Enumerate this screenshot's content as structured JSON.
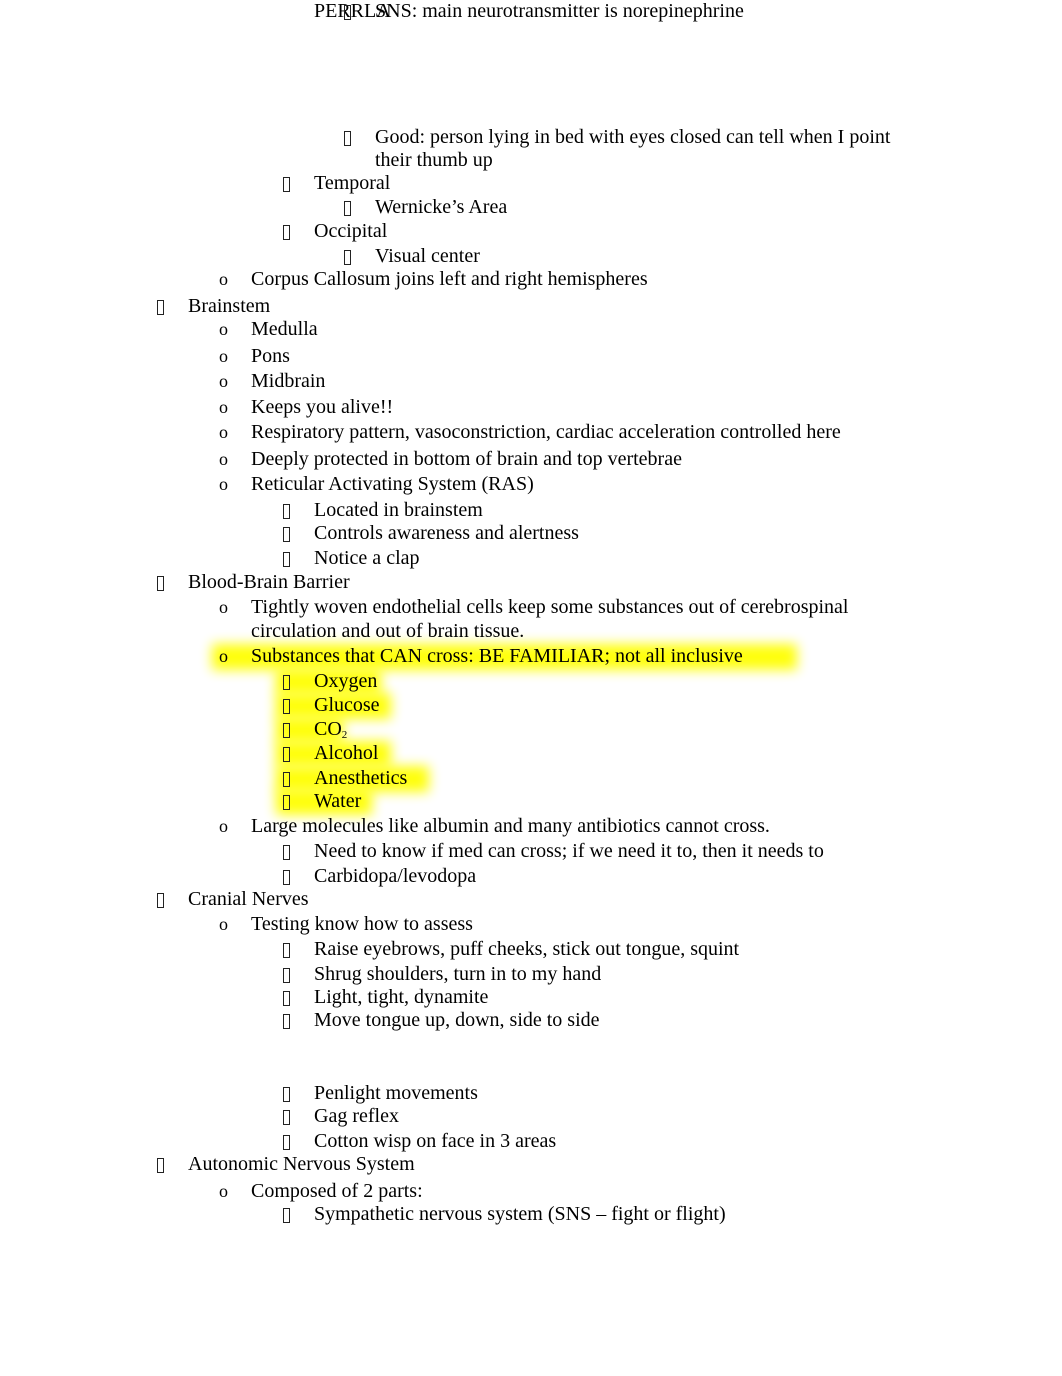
{
  "document": {
    "highlight_color": "#ffff00",
    "lines": [
      {
        "level": 4,
        "text": "Good: person lying in bed with eyes closed can tell when I point",
        "continuation": "their thumb up"
      },
      {
        "level": 3,
        "text": "Temporal"
      },
      {
        "level": 4,
        "text": "Wernicke’s Area"
      },
      {
        "level": 3,
        "text": "Occipital"
      },
      {
        "level": 4,
        "text": "Visual center"
      },
      {
        "level": 2,
        "text": "Corpus Callosum joins left and right hemispheres"
      },
      {
        "level": 1,
        "text": "Brainstem"
      },
      {
        "level": 2,
        "text": "Medulla"
      },
      {
        "level": 2,
        "text": "Pons"
      },
      {
        "level": 2,
        "text": "Midbrain"
      },
      {
        "level": 2,
        "text": "Keeps you alive!!"
      },
      {
        "level": 2,
        "text": "Respiratory pattern, vasoconstriction, cardiac acceleration controlled here"
      },
      {
        "level": 2,
        "text": "Deeply protected in bottom of brain and top vertebrae"
      },
      {
        "level": 2,
        "text": "Reticular Activating System (RAS)"
      },
      {
        "level": 3,
        "text": "Located in brainstem"
      },
      {
        "level": 3,
        "text": "Controls awareness and alertness"
      },
      {
        "level": 3,
        "text": "Notice a clap"
      },
      {
        "level": 1,
        "text": "Blood-Brain Barrier"
      },
      {
        "level": 2,
        "text": "Tightly woven endothelial cells keep some substances out of cerebrospinal",
        "continuation": "circulation and out of brain tissue."
      },
      {
        "level": 2,
        "text": "Substances that CAN cross: BE FAMILIAR; not all inclusive",
        "highlighted": true
      },
      {
        "level": 3,
        "text": "Oxygen",
        "highlighted": true
      },
      {
        "level": 3,
        "text": "Glucose",
        "highlighted": true
      },
      {
        "level": 3,
        "text": "CO",
        "subscript": "2",
        "highlighted": true
      },
      {
        "level": 3,
        "text": "Alcohol",
        "highlighted": true
      },
      {
        "level": 3,
        "text": "Anesthetics",
        "highlighted": true
      },
      {
        "level": 3,
        "text": "Water",
        "highlighted": true
      },
      {
        "level": 2,
        "text": "Large molecules like albumin and many antibiotics cannot cross."
      },
      {
        "level": 3,
        "text": "Need to know if med can cross; if we need it to, then it needs to"
      },
      {
        "level": 3,
        "text": "Carbidopa/levodopa"
      },
      {
        "level": 1,
        "text": "Cranial Nerves"
      },
      {
        "level": 2,
        "text": "Testing know how to assess"
      },
      {
        "level": 3,
        "text": "Raise eyebrows, puff cheeks, stick out tongue, squint"
      },
      {
        "level": 3,
        "text": "Shrug shoulders, turn in to my hand"
      },
      {
        "level": 3,
        "text": "Light, tight, dynamite"
      },
      {
        "level": 3,
        "text": "Move tongue up, down, side to side"
      },
      {
        "level": 3,
        "text": "Penlight movements",
        "continuation": "PERRLA"
      },
      {
        "level": 3,
        "text": "Gag reflex"
      },
      {
        "level": 3,
        "text": "Cotton wisp on face in 3 areas"
      },
      {
        "level": 1,
        "text": "Autonomic Nervous System"
      },
      {
        "level": 2,
        "text": "Composed of 2 parts:"
      },
      {
        "level": 3,
        "text": "Sympathetic nervous system (SNS – fight or flight)"
      },
      {
        "level": 4,
        "text": "SNS: main neurotransmitter is norepinephrine"
      }
    ],
    "bullet_glyphs": {
      "level1": "square-bullet",
      "level2": "o",
      "level3": "square-bullet",
      "level4": "square-bullet"
    }
  }
}
